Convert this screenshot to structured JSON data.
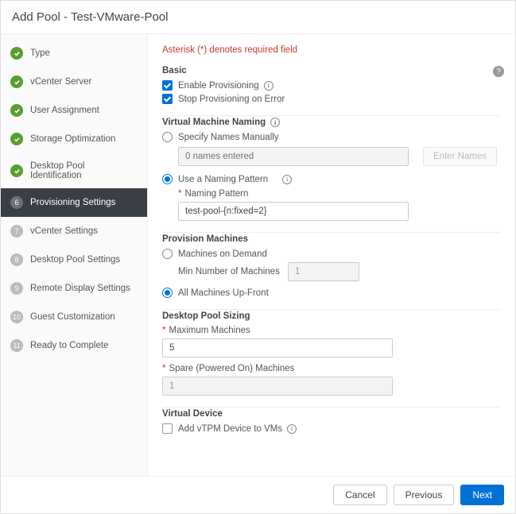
{
  "header": {
    "title": "Add Pool - Test-VMware-Pool"
  },
  "sidebar": {
    "steps": [
      {
        "label": "Type",
        "state": "done"
      },
      {
        "label": "vCenter Server",
        "state": "done"
      },
      {
        "label": "User Assignment",
        "state": "done"
      },
      {
        "label": "Storage Optimization",
        "state": "done"
      },
      {
        "label": "Desktop Pool Identification",
        "state": "done"
      },
      {
        "label": "Provisioning Settings",
        "state": "active",
        "num": "6"
      },
      {
        "label": "vCenter Settings",
        "state": "pending",
        "num": "7"
      },
      {
        "label": "Desktop Pool Settings",
        "state": "pending",
        "num": "8"
      },
      {
        "label": "Remote Display Settings",
        "state": "pending",
        "num": "9"
      },
      {
        "label": "Guest Customization",
        "state": "pending",
        "num": "10"
      },
      {
        "label": "Ready to Complete",
        "state": "pending",
        "num": "11"
      }
    ]
  },
  "content": {
    "required_note": "Asterisk (*) denotes required field",
    "basic": {
      "title": "Basic",
      "enable_provisioning": "Enable Provisioning",
      "stop_on_error": "Stop Provisioning on Error"
    },
    "vm_naming": {
      "title": "Virtual Machine Naming",
      "specify_manually": "Specify Names Manually",
      "names_entered_placeholder": "0 names entered",
      "enter_names_btn": "Enter Names",
      "use_pattern": "Use a Naming Pattern",
      "naming_pattern_label": "Naming Pattern",
      "naming_pattern_value": "test-pool-{n:fixed=2}"
    },
    "provision_machines": {
      "title": "Provision Machines",
      "on_demand": "Machines on Demand",
      "min_number_label": "Min Number of Machines",
      "min_number_value": "1",
      "all_upfront": "All Machines Up-Front"
    },
    "pool_sizing": {
      "title": "Desktop Pool Sizing",
      "max_machines_label": "Maximum Machines",
      "max_machines_value": "5",
      "spare_label": "Spare (Powered On) Machines",
      "spare_value": "1"
    },
    "virtual_device": {
      "title": "Virtual Device",
      "add_vtpm": "Add vTPM Device to VMs"
    }
  },
  "footer": {
    "cancel": "Cancel",
    "previous": "Previous",
    "next": "Next"
  }
}
